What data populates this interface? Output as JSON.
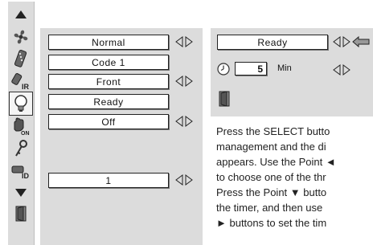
{
  "menu": {
    "fields": [
      "Normal",
      "Code 1",
      "Front",
      "Ready",
      "Off",
      "1"
    ]
  },
  "sub": {
    "mode": "Ready",
    "timer_value": "5",
    "timer_unit": "Min"
  },
  "description": [
    "Press the SELECT butto",
    "management and the di",
    "appears. Use the Point ◄",
    "to choose one of the thr",
    "Press the Point ▼ butto",
    "the timer, and then use",
    "► buttons to set the tim"
  ],
  "icons": [
    "up-arrow-icon",
    "fan-icon",
    "remote-icon",
    "remote-ir-icon",
    "lamp-icon",
    "hand-on-icon",
    "key-icon",
    "remote-id-icon",
    "down-arrow-icon",
    "exit-door-icon"
  ],
  "colors": {
    "panel": "#dcdcdc",
    "field": "#ffffff",
    "border": "#222222"
  }
}
